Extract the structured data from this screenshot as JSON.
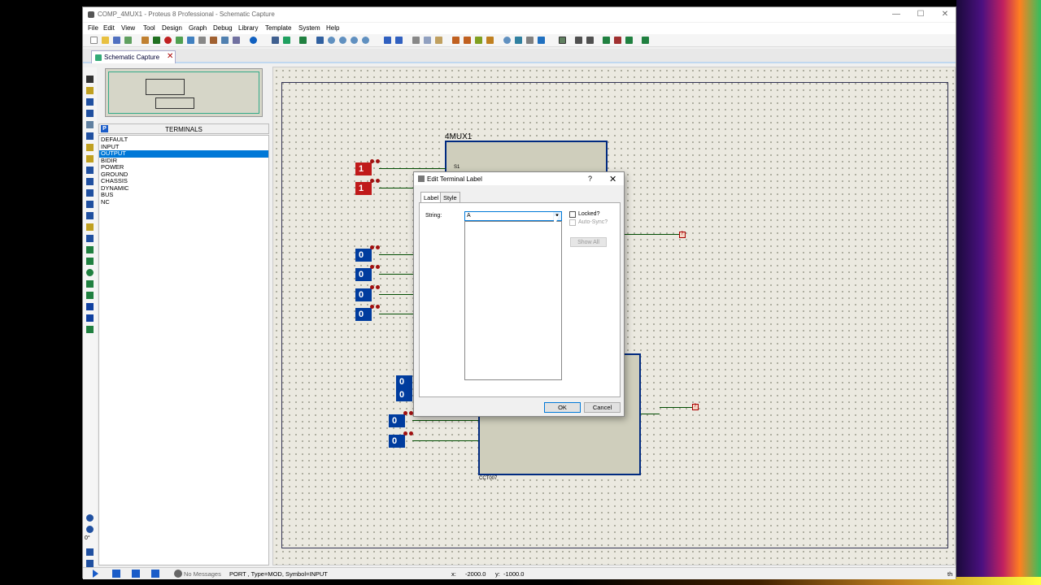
{
  "window": {
    "title": "COMP_4MUX1 - Proteus 8 Professional - Schematic Capture",
    "minimize": "—",
    "maximize": "☐",
    "close": "✕"
  },
  "menu": [
    "File",
    "Edit",
    "View",
    "Tool",
    "Design",
    "Graph",
    "Debug",
    "Library",
    "Template",
    "System",
    "Help"
  ],
  "tab": {
    "label": "Schematic Capture",
    "close": "✕"
  },
  "terminals": {
    "header": "TERMINALS",
    "mode_icon": "P",
    "items": [
      "DEFAULT",
      "INPUT",
      "OUTPUT",
      "BIDIR",
      "POWER",
      "GROUND",
      "CHASSIS",
      "DYNAMIC",
      "BUS",
      "NC"
    ],
    "selected": "OUTPUT"
  },
  "schematic": {
    "top_title": "4MUX1",
    "bottom_label": "CCT007",
    "top_pin_label": "S1",
    "logic_inputs": [
      "1",
      "1",
      "0",
      "0",
      "0",
      "0",
      "0",
      "0",
      "0",
      "0"
    ],
    "output_marker": "?"
  },
  "dialog": {
    "title": "Edit Terminal Label",
    "help": "?",
    "close": "✕",
    "tabs": [
      "Label",
      "Style"
    ],
    "string_label": "String:",
    "string_value": "A",
    "dropdown_arrow": "▾",
    "locked_label": "Locked?",
    "autosync_label": "Auto-Sync?",
    "show_all": "Show All",
    "ok": "OK",
    "cancel": "Cancel"
  },
  "status": {
    "rotation": "0°",
    "messages": "No Messages",
    "info": "PORT , Type=MOD, Symbol=INPUT",
    "x_label": "x:",
    "x": "-2000.0",
    "y_label": "y:",
    "y": "-1000.0",
    "unit": "th"
  }
}
